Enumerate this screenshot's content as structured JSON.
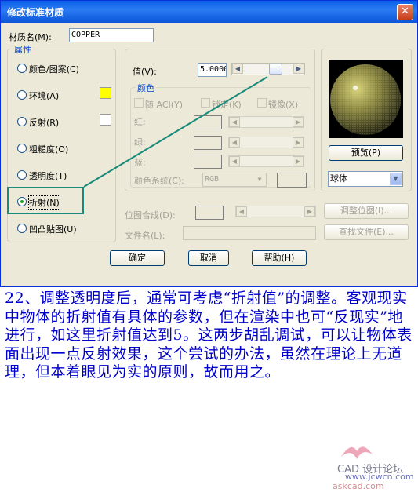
{
  "dialog": {
    "title": "修改标准材质",
    "close_glyph": "✕",
    "material_name_label": "材质名(M):",
    "material_name_value": "COPPER",
    "attributes_group_title": "属性",
    "attributes": [
      {
        "label": "颜色/图案(C)",
        "selected": false
      },
      {
        "label": "环境(A)",
        "selected": false
      },
      {
        "label": "反射(R)",
        "selected": false
      },
      {
        "label": "粗糙度(O)",
        "selected": false
      },
      {
        "label": "透明度(T)",
        "selected": false
      },
      {
        "label": "折射(N)",
        "selected": true
      },
      {
        "label": "凹凸贴图(U)",
        "selected": false
      }
    ],
    "environment_swatch_color": "#ffff00",
    "reflection_swatch_color": "#ffffff",
    "value_label": "值(V):",
    "value": "5.0000",
    "color_group_title": "颜色",
    "color_checks": [
      "随 ACI(Y)",
      "锁定(K)",
      "镜像(X)"
    ],
    "channel_labels": [
      "红:",
      "绿:",
      "蓝:"
    ],
    "color_system_label": "颜色系统(C):",
    "color_system_value": "RGB",
    "bitmap_blend_label": "位图合成(D):",
    "file_name_label": "文件名(L):",
    "adjust_bitmap_button": "调整位图(I)...",
    "find_file_button": "查找文件(E)...",
    "preview_button": "预览(P)",
    "preview_shape_value": "球体",
    "ok_button": "确定",
    "cancel_button": "取消",
    "help_button": "帮助(H)"
  },
  "caption": {
    "text": "22、调整透明度后，通常可考虑“折射值”的调整。客观现实中物体的折射值有具体的参数，但在渲染中也可“反现实”地进行，如这里折射值达到5。这两步胡乱调试，可以让物体表面出现一点反射效果，这个尝试的办法，虽然在理论上无道理，但本着眼见为实的原则，故而用之。"
  },
  "watermark": {
    "brand": "CAD 设计论坛",
    "url1": "www.jcwcn.com",
    "url2": "askcad.com"
  },
  "colors": {
    "annotation": "#1a8a7a",
    "caption_text": "#0000cc",
    "title_bar": "#0a5fe6"
  }
}
